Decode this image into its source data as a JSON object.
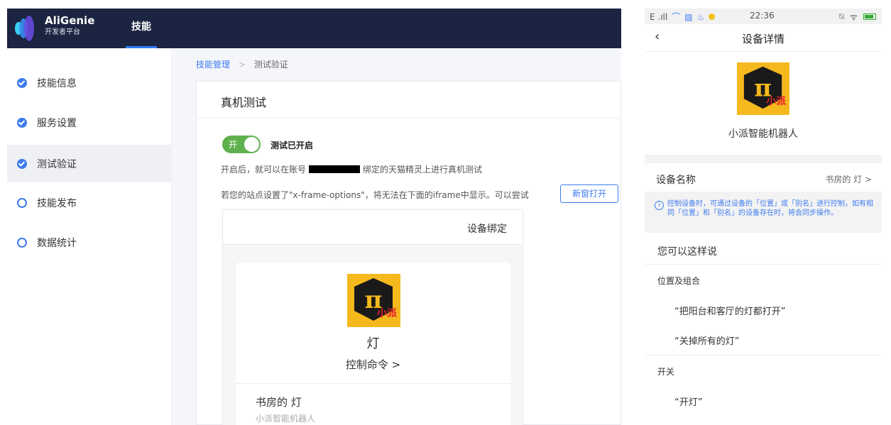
{
  "console": {
    "brand_name": "AliGenie",
    "brand_sub": "开发者平台",
    "nav_tab": "技能",
    "sidebar": {
      "items": [
        {
          "label": "技能信息",
          "state": "done"
        },
        {
          "label": "服务设置",
          "state": "done"
        },
        {
          "label": "测试验证",
          "state": "done",
          "active": true
        },
        {
          "label": "技能发布",
          "state": "todo"
        },
        {
          "label": "数据统计",
          "state": "todo"
        }
      ]
    },
    "breadcrumb": {
      "link": "技能管理",
      "sep": ">",
      "current": "测试验证"
    },
    "panel": {
      "title": "真机测试",
      "toggle_label": "开",
      "toggle_status": "测试已开启",
      "info_before": "开启后，就可以在账号",
      "info_after": "绑定的天猫精灵上进行真机测试",
      "iframe_note": "若您的站点设置了\"x-frame-options\"，将无法在下面的iframe中显示。可以尝试",
      "new_window_button": "新窗打开",
      "iframe": {
        "header_title": "设备绑定",
        "logo_text": "小派",
        "device_name": "灯",
        "control_label": "控制命令 >",
        "room_device": "书房的 灯",
        "room_sub": "小派智能机器人"
      }
    }
  },
  "phone": {
    "status": {
      "left": "E .ıll",
      "time": "22:36"
    },
    "back_icon": "‹",
    "title": "设备详情",
    "logo_text": "小派",
    "device_title": "小派智能机器人",
    "name_row": {
      "label": "设备名称",
      "value": "书房的 灯  >"
    },
    "hint": "控制设备时，可通过设备的「位置」或「别名」进行控制，如有相同「位置」和「别名」的设备存在时，将会同步操作。",
    "say_title": "您可以这样说",
    "groups": [
      {
        "label": "位置及组合",
        "phrases": [
          "“把阳台和客厅的灯都打开”",
          "“关掉所有的灯”"
        ]
      },
      {
        "label": "开关",
        "phrases": [
          "“开灯”"
        ]
      }
    ]
  },
  "colors": {
    "topbar": "#1b2440",
    "accent": "#3e7cf0",
    "toggle_on": "#5fb14e",
    "logo_bg": "#f5b91e",
    "logo_text": "#e8222a"
  }
}
